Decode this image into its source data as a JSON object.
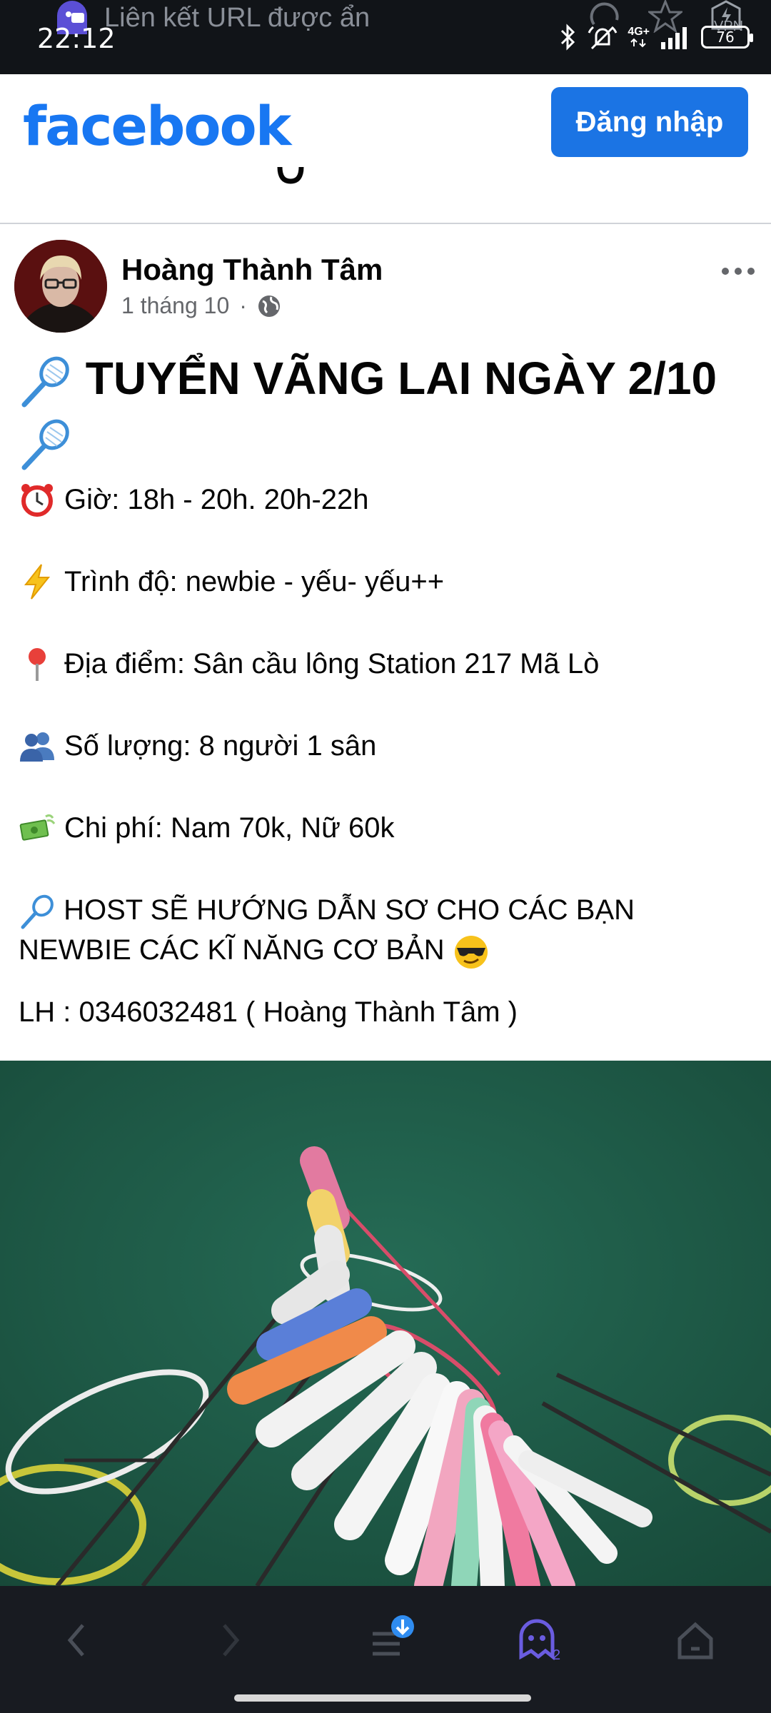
{
  "status_bar": {
    "time": "22:12",
    "hidden_url_text": "Liên kết URL được ẩn",
    "network": "4G+",
    "battery": "76",
    "vpn_label": "VPN"
  },
  "header": {
    "logo": "facebook",
    "login_label": "Đăng nhập",
    "brand_color": "#1877f2"
  },
  "post": {
    "author": "Hoàng Thành Tâm",
    "date": "1 tháng 10",
    "separator": "·",
    "headline": "TUYỂN VÃNG LAI NGÀY 2/10",
    "lines": [
      {
        "icon": "alarm-clock-icon",
        "text": "Giờ: 18h - 20h.  20h-22h"
      },
      {
        "icon": "lightning-icon",
        "text": "Trình độ: newbie - yếu- yếu++"
      },
      {
        "icon": "location-pin-icon",
        "text": "Địa điểm: Sân cầu lông Station 217 Mã Lò"
      },
      {
        "icon": "people-icon",
        "text": "Số lượng: 8 người 1 sân"
      },
      {
        "icon": "money-icon",
        "text": "Chi phí: Nam 70k, Nữ 60k"
      }
    ],
    "host_line_1": "HOST SẼ HƯỚNG DẪN SƠ CHO CÁC BẠN",
    "host_line_2": "NEWBIE CÁC KĨ NĂNG CƠ BẢN",
    "contact": "LH : 0346032481  ( Hoàng Thành Tâm )"
  },
  "browser_bar": {
    "tabs_badge": "2"
  }
}
